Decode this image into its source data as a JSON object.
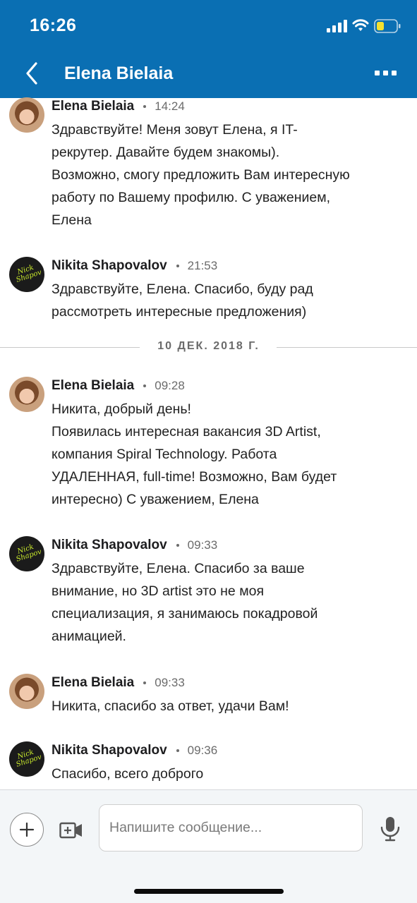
{
  "status_bar": {
    "time": "16:26"
  },
  "nav": {
    "title": "Elena Bielaia"
  },
  "messages": [
    {
      "sender": "Elena Bielaia",
      "time": "14:24",
      "avatar": "elena",
      "lines": [
        "Здравствуйте! Меня зовут Елена, я IT-",
        "рекрутер. Давайте будем знакомы).",
        "Возможно, смогу предложить Вам интересную",
        "работу по Вашему профилю. С уважением,",
        "Елена"
      ]
    },
    {
      "sender": "Nikita Shapovalov",
      "time": "21:53",
      "avatar": "nikita",
      "lines": [
        "Здравствуйте, Елена. Спасибо, буду рад",
        "рассмотреть интересные предложения)"
      ]
    },
    {
      "sender": "Elena Bielaia",
      "time": "09:28",
      "avatar": "elena",
      "lines": [
        "Никита, добрый день!",
        "Появилась интересная вакансия 3D Artist,",
        "компания Spiral Technology. Работа",
        "УДАЛЕННАЯ, full-time! Возможно, Вам будет",
        "интересно) С уважением, Елена"
      ]
    },
    {
      "sender": "Nikita Shapovalov",
      "time": "09:33",
      "avatar": "nikita",
      "lines": [
        "Здравствуйте, Елена. Спасибо за ваше",
        "внимание, но 3D artist это не моя",
        "специализация, я занимаюсь покадровой",
        "анимацией."
      ]
    },
    {
      "sender": "Elena Bielaia",
      "time": "09:33",
      "avatar": "elena",
      "lines": [
        "Никита, спасибо за ответ, удачи Вам!"
      ]
    },
    {
      "sender": "Nikita Shapovalov",
      "time": "09:36",
      "avatar": "nikita",
      "lines": [
        "Спасибо, всего доброго"
      ]
    }
  ],
  "date_divider": "10 ДЕК. 2018 Г.",
  "composer": {
    "placeholder": "Напишите сообщение..."
  },
  "colors": {
    "header": "#0a6fb3",
    "avatar_logo": "#c8e82c"
  }
}
